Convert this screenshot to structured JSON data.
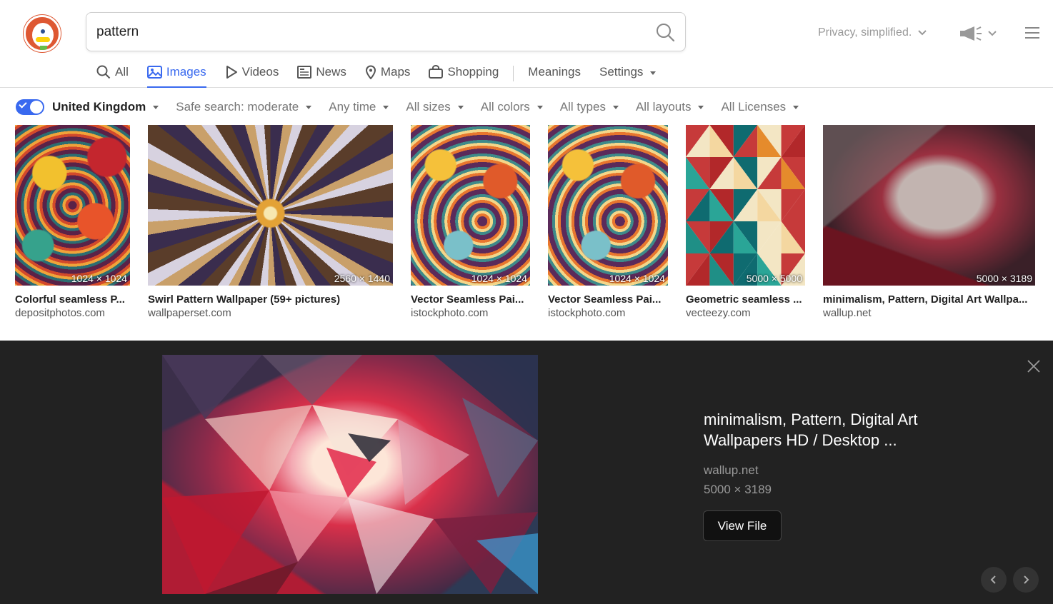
{
  "search": {
    "query": "pattern"
  },
  "header": {
    "privacy_text": "Privacy, simplified."
  },
  "nav": {
    "all": "All",
    "images": "Images",
    "videos": "Videos",
    "news": "News",
    "maps": "Maps",
    "shopping": "Shopping",
    "meanings": "Meanings",
    "settings": "Settings"
  },
  "filters": {
    "region": "United Kingdom",
    "safe_search": "Safe search: moderate",
    "time": "Any time",
    "sizes": "All sizes",
    "colors": "All colors",
    "types": "All types",
    "layouts": "All layouts",
    "licenses": "All Licenses"
  },
  "results": [
    {
      "title": "Colorful seamless P...",
      "source": "depositphotos.com",
      "dims": "1024 × 1024"
    },
    {
      "title": "Swirl Pattern Wallpaper (59+ pictures)",
      "source": "wallpaperset.com",
      "dims": "2560 × 1440"
    },
    {
      "title": "Vector Seamless Pai...",
      "source": "istockphoto.com",
      "dims": "1024 × 1024"
    },
    {
      "title": "Vector Seamless Pai...",
      "source": "istockphoto.com",
      "dims": "1024 × 1024"
    },
    {
      "title": "Geometric seamless ...",
      "source": "vecteezy.com",
      "dims": "5000 × 5000"
    },
    {
      "title": "minimalism, Pattern, Digital Art Wallpa...",
      "source": "wallup.net",
      "dims": "5000 × 3189"
    }
  ],
  "preview": {
    "title": "minimalism, Pattern, Digital Art Wallpapers HD / Desktop ...",
    "source": "wallup.net",
    "dims": "5000 × 3189",
    "view_file": "View File"
  },
  "colors": {
    "accent": "#3969ef",
    "brand": "#de5833",
    "preview_bg": "#222222"
  }
}
